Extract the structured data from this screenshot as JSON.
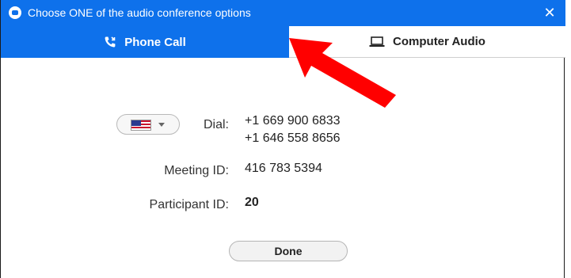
{
  "window": {
    "title": "Choose ONE of the audio conference options",
    "close_label": "✕"
  },
  "tabs": [
    {
      "label": "Phone Call",
      "icon": "phone-icon",
      "active": true
    },
    {
      "label": "Computer Audio",
      "icon": "laptop-icon",
      "active": false
    }
  ],
  "dial": {
    "country_icon": "us-flag-icon",
    "label": "Dial:",
    "numbers": [
      "+1 669 900 6833",
      "+1 646 558 8656"
    ]
  },
  "meeting": {
    "label": "Meeting ID:",
    "value": "416 783 5394"
  },
  "participant": {
    "label": "Participant ID:",
    "value": "20"
  },
  "done_label": "Done",
  "colors": {
    "accent": "#0e71eb",
    "annotation_arrow": "#ff0000"
  }
}
